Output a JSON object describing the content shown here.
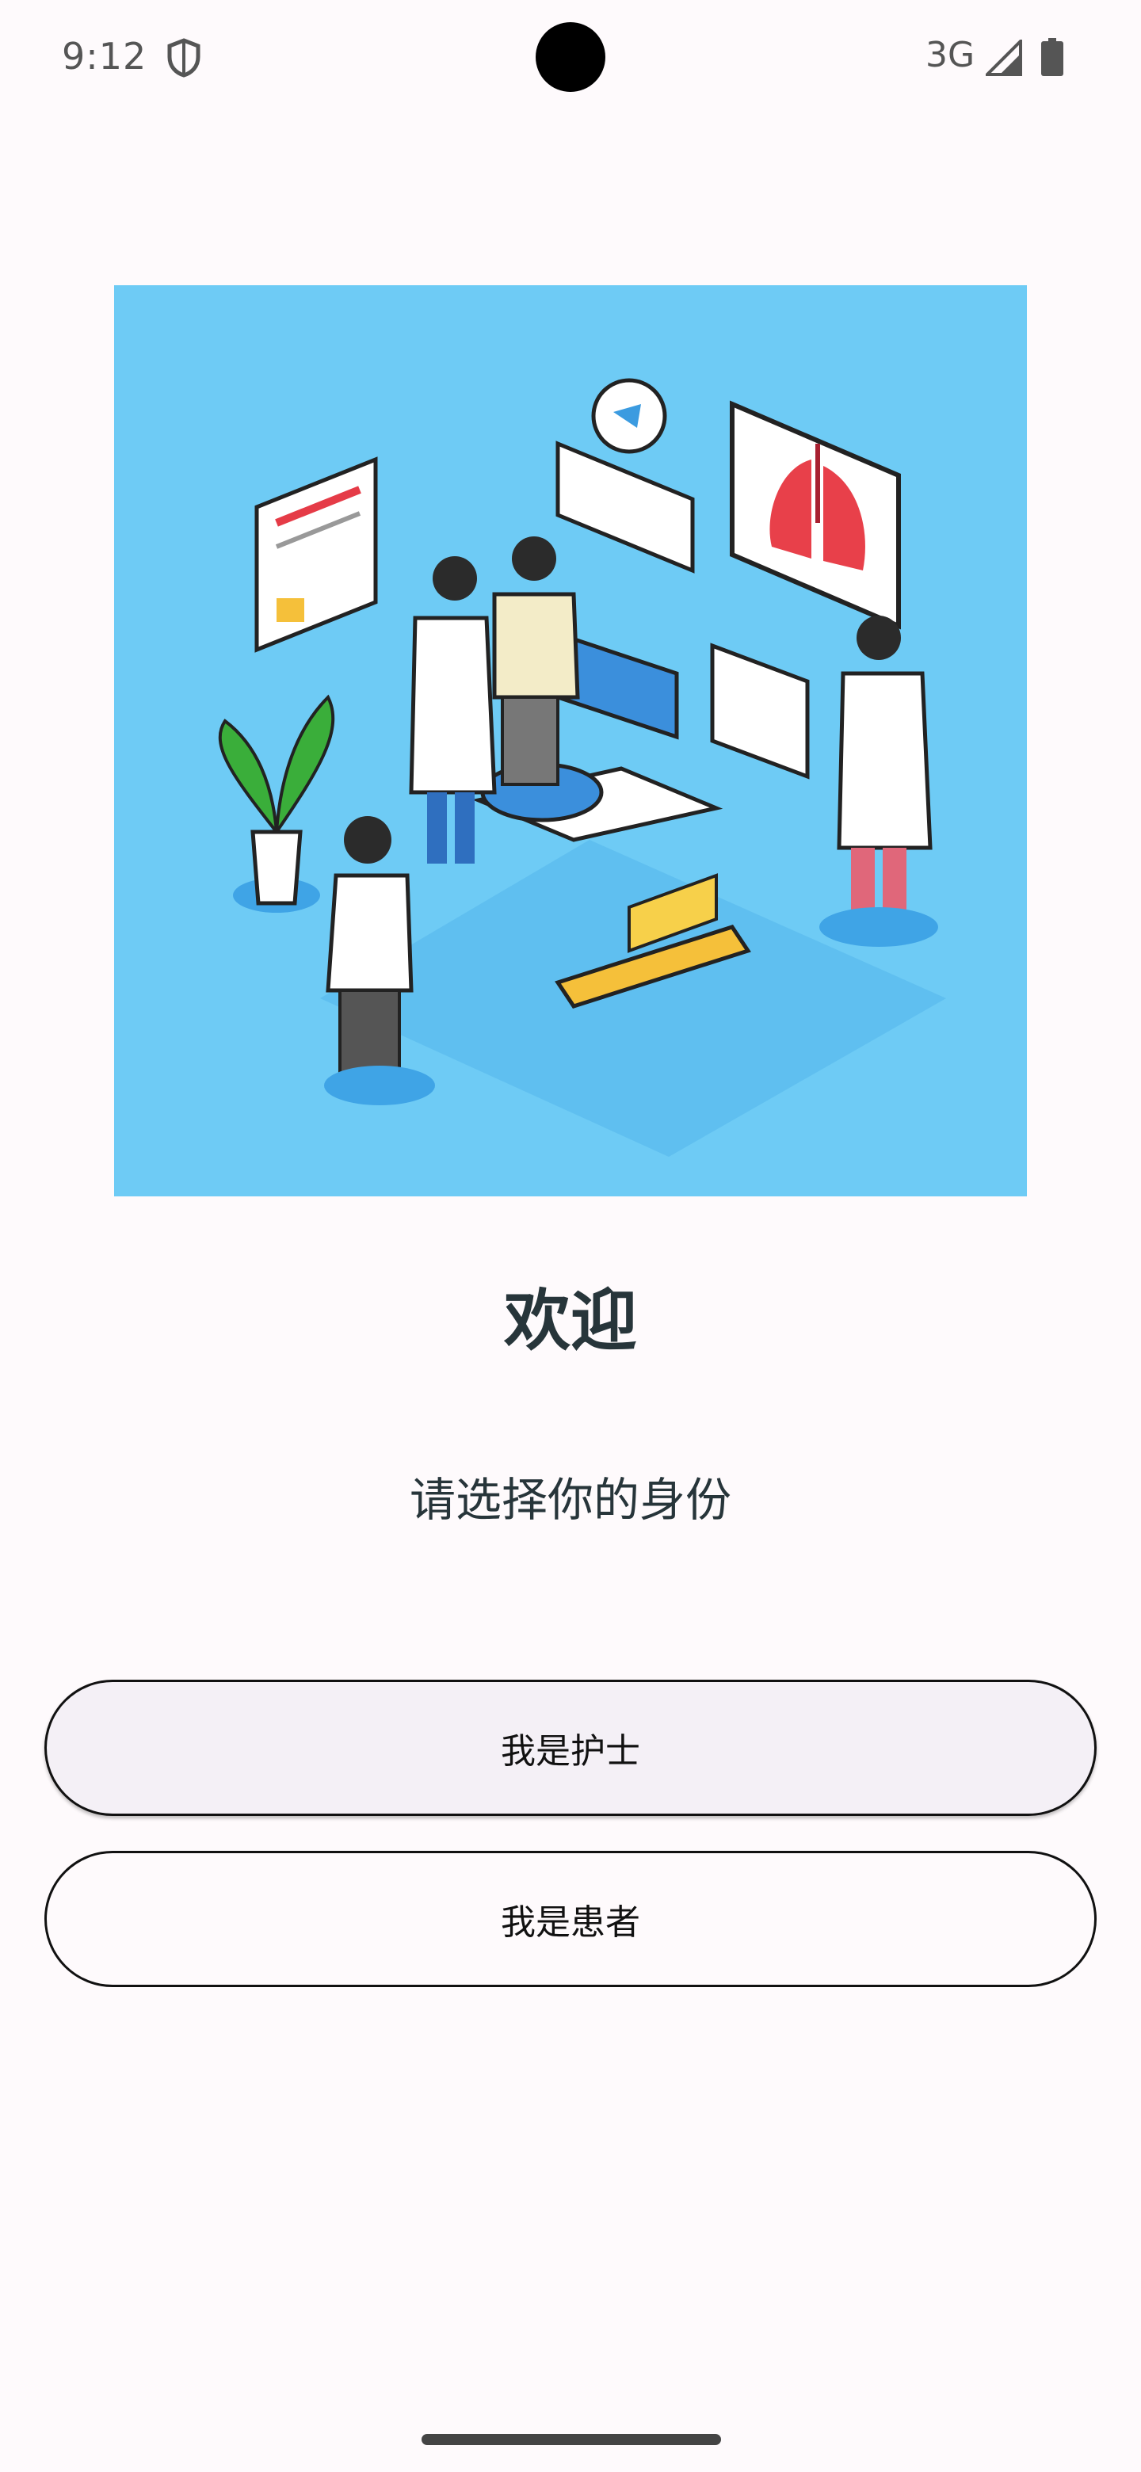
{
  "status_bar": {
    "time": "9:12",
    "network": "3G",
    "icons": [
      "shield-icon",
      "signal-icon",
      "battery-icon"
    ]
  },
  "hero": {
    "image_description_icon": "medical-team-illustration",
    "background_color": "#6ecbf5"
  },
  "welcome": {
    "title": "欢迎",
    "subtitle": "请选择你的身份"
  },
  "buttons": {
    "nurse_label": "我是护士",
    "patient_label": "我是患者"
  }
}
